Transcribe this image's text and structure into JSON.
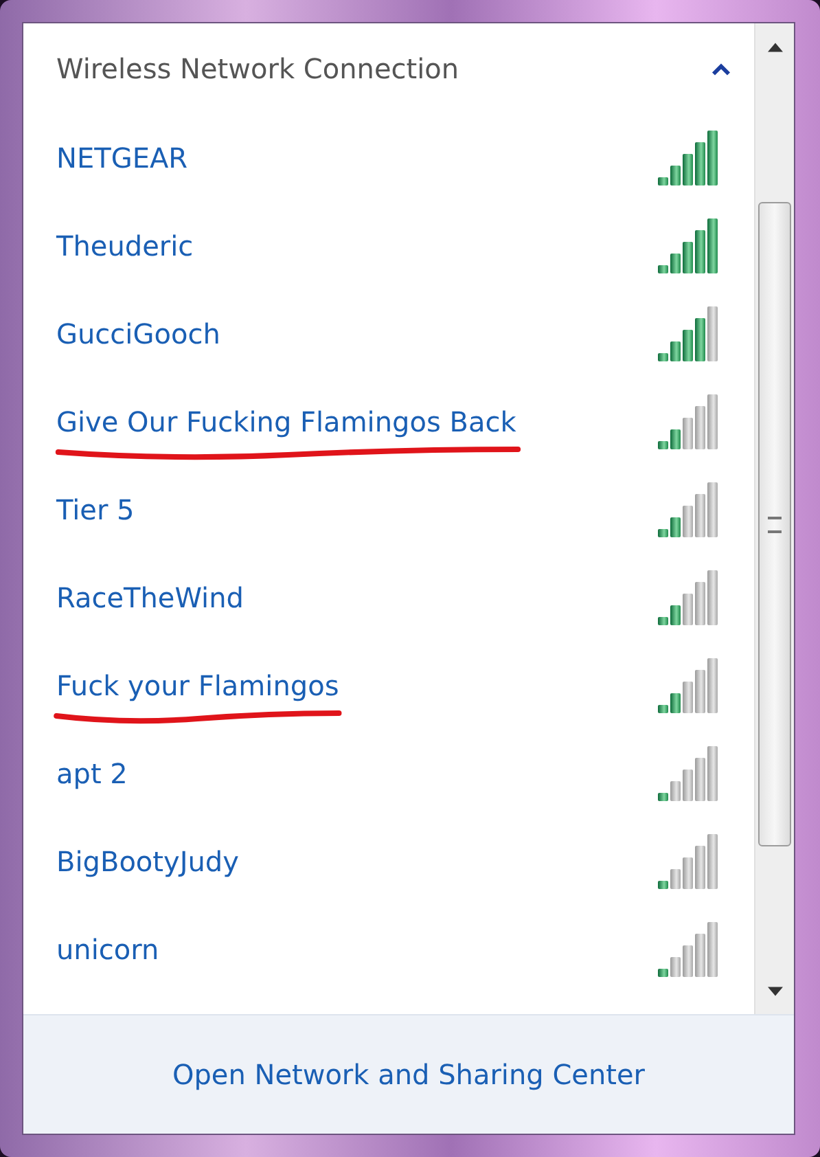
{
  "header": {
    "title": "Wireless Network Connection",
    "expanded": true
  },
  "networks": [
    {
      "name": "NETGEAR",
      "kind": "excellent",
      "underlined": false
    },
    {
      "name": "Theuderic",
      "kind": "excellent",
      "underlined": false
    },
    {
      "name": "GucciGooch",
      "kind": "good",
      "underlined": false
    },
    {
      "name": "Give Our Fucking Flamingos Back",
      "kind": "low",
      "underlined": true
    },
    {
      "name": "Tier 5",
      "kind": "low",
      "underlined": false
    },
    {
      "name": "RaceTheWind",
      "kind": "low",
      "underlined": false
    },
    {
      "name": "Fuck your Flamingos",
      "kind": "low",
      "underlined": true
    },
    {
      "name": "apt 2",
      "kind": "weak",
      "underlined": false
    },
    {
      "name": "BigBootyJudy",
      "kind": "weak",
      "underlined": false
    },
    {
      "name": "unicorn",
      "kind": "weak",
      "underlined": false
    }
  ],
  "footer": {
    "link": "Open Network and Sharing Center"
  }
}
